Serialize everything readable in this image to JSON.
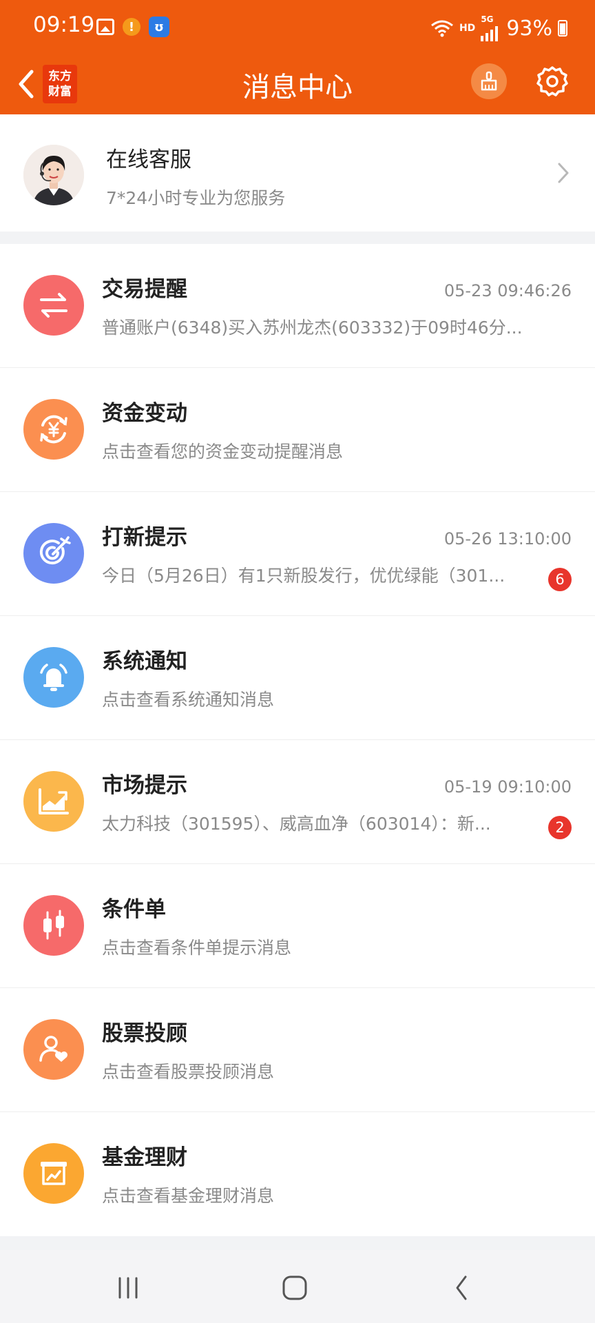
{
  "status_bar": {
    "time": "09:19",
    "network": "HD",
    "network_gen": "5G",
    "battery": "93%"
  },
  "header": {
    "logo_line1": "东方",
    "logo_line2": "财富",
    "title": "消息中心"
  },
  "service": {
    "title": "在线客服",
    "subtitle": "7*24小时专业为您服务"
  },
  "messages": [
    {
      "title": "交易提醒",
      "time": "05-23 09:46:26",
      "desc": "普通账户(6348)买入苏州龙杰(603332)于09时46分...",
      "badge": "",
      "icon": "exchange-icon",
      "color": "#f66a6a"
    },
    {
      "title": "资金变动",
      "time": "",
      "desc": "点击查看您的资金变动提醒消息",
      "badge": "",
      "icon": "yuan-cycle-icon",
      "color": "#fb8f50"
    },
    {
      "title": "打新提示",
      "time": "05-26 13:10:00",
      "desc": "今日（5月26日）有1只新股发行，优优绿能（301...",
      "badge": "6",
      "icon": "target-icon",
      "color": "#6e8df2"
    },
    {
      "title": "系统通知",
      "time": "",
      "desc": "点击查看系统通知消息",
      "badge": "",
      "icon": "bell-icon",
      "color": "#5aaaf0"
    },
    {
      "title": "市场提示",
      "time": "05-19 09:10:00",
      "desc": "太力科技（301595）、威高血净（603014）：新...",
      "badge": "2",
      "icon": "trend-chart-icon",
      "color": "#fbb74c"
    },
    {
      "title": "条件单",
      "time": "",
      "desc": "点击查看条件单提示消息",
      "badge": "",
      "icon": "candlestick-icon",
      "color": "#f66a6a"
    },
    {
      "title": "股票投顾",
      "time": "",
      "desc": "点击查看股票投顾消息",
      "badge": "",
      "icon": "advisor-icon",
      "color": "#fb8f50"
    },
    {
      "title": "基金理财",
      "time": "",
      "desc": "点击查看基金理财消息",
      "badge": "",
      "icon": "fund-icon",
      "color": "#fba731"
    }
  ]
}
